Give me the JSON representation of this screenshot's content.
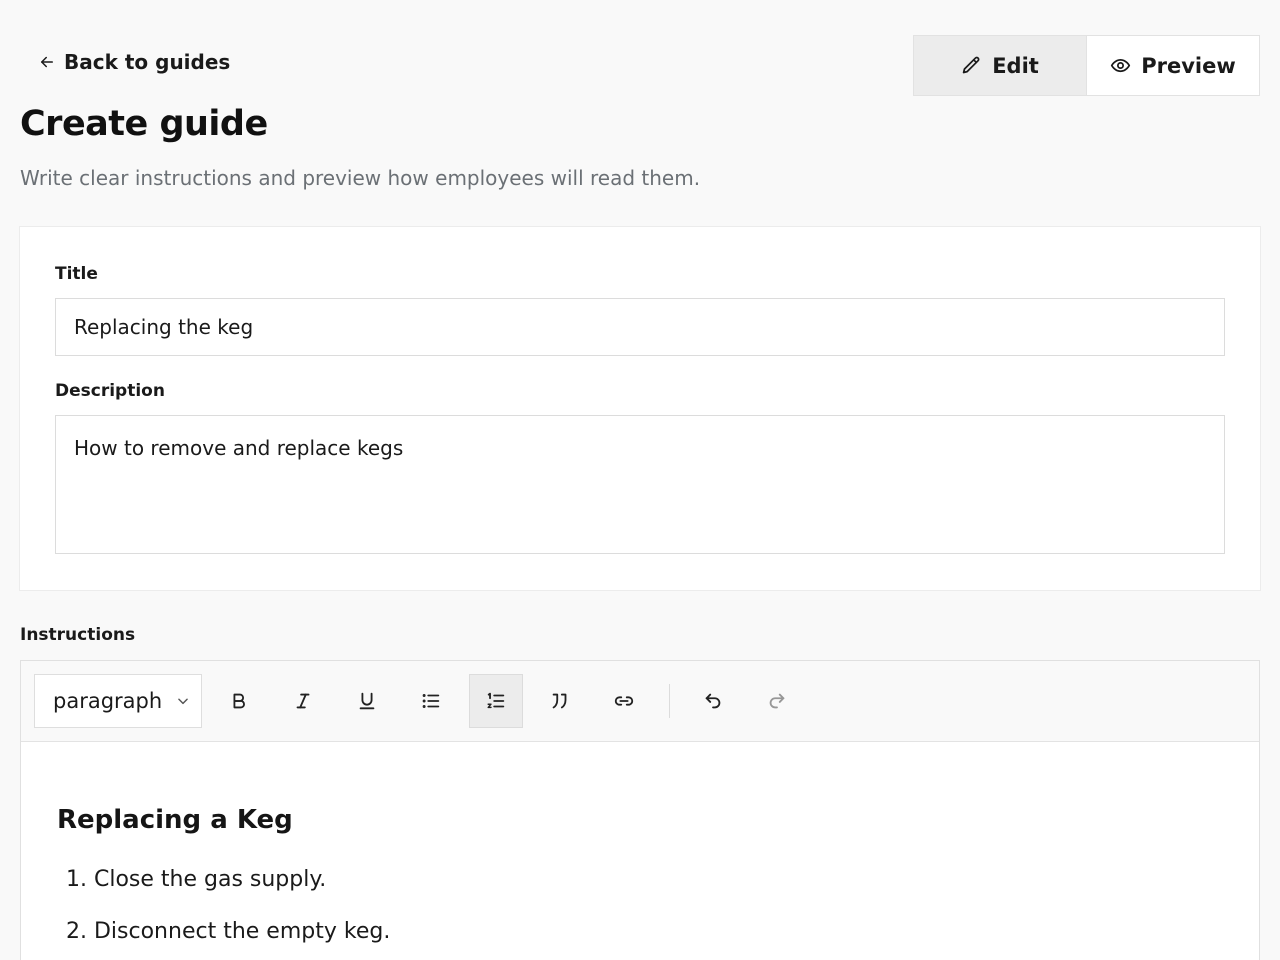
{
  "nav": {
    "back_label": "Back to guides"
  },
  "mode_toggle": {
    "edit_label": "Edit",
    "preview_label": "Preview",
    "active": "edit"
  },
  "header": {
    "title": "Create guide",
    "subtitle": "Write clear instructions and preview how employees will read them."
  },
  "form": {
    "title_label": "Title",
    "title_value": "Replacing the keg",
    "description_label": "Description",
    "description_value": "How to remove and replace kegs"
  },
  "instructions": {
    "label": "Instructions",
    "toolbar": {
      "block_type": "paragraph",
      "tools": [
        {
          "name": "bold",
          "icon": "bold-icon"
        },
        {
          "name": "italic",
          "icon": "italic-icon"
        },
        {
          "name": "underline",
          "icon": "underline-icon"
        },
        {
          "name": "bullet-list",
          "icon": "bullet-list-icon"
        },
        {
          "name": "numbered-list",
          "icon": "numbered-list-icon",
          "active": true
        },
        {
          "name": "quote",
          "icon": "quote-icon"
        },
        {
          "name": "link",
          "icon": "link-icon"
        },
        {
          "name": "undo",
          "icon": "undo-icon"
        },
        {
          "name": "redo",
          "icon": "redo-icon",
          "disabled": true
        }
      ]
    },
    "content": {
      "heading": "Replacing a Keg",
      "steps": [
        "1. Close the gas supply.",
        "2. Disconnect the empty keg."
      ]
    }
  },
  "colors": {
    "background": "#f9f9f9",
    "active_toggle": "#ececec",
    "muted_text": "#6b7075"
  }
}
